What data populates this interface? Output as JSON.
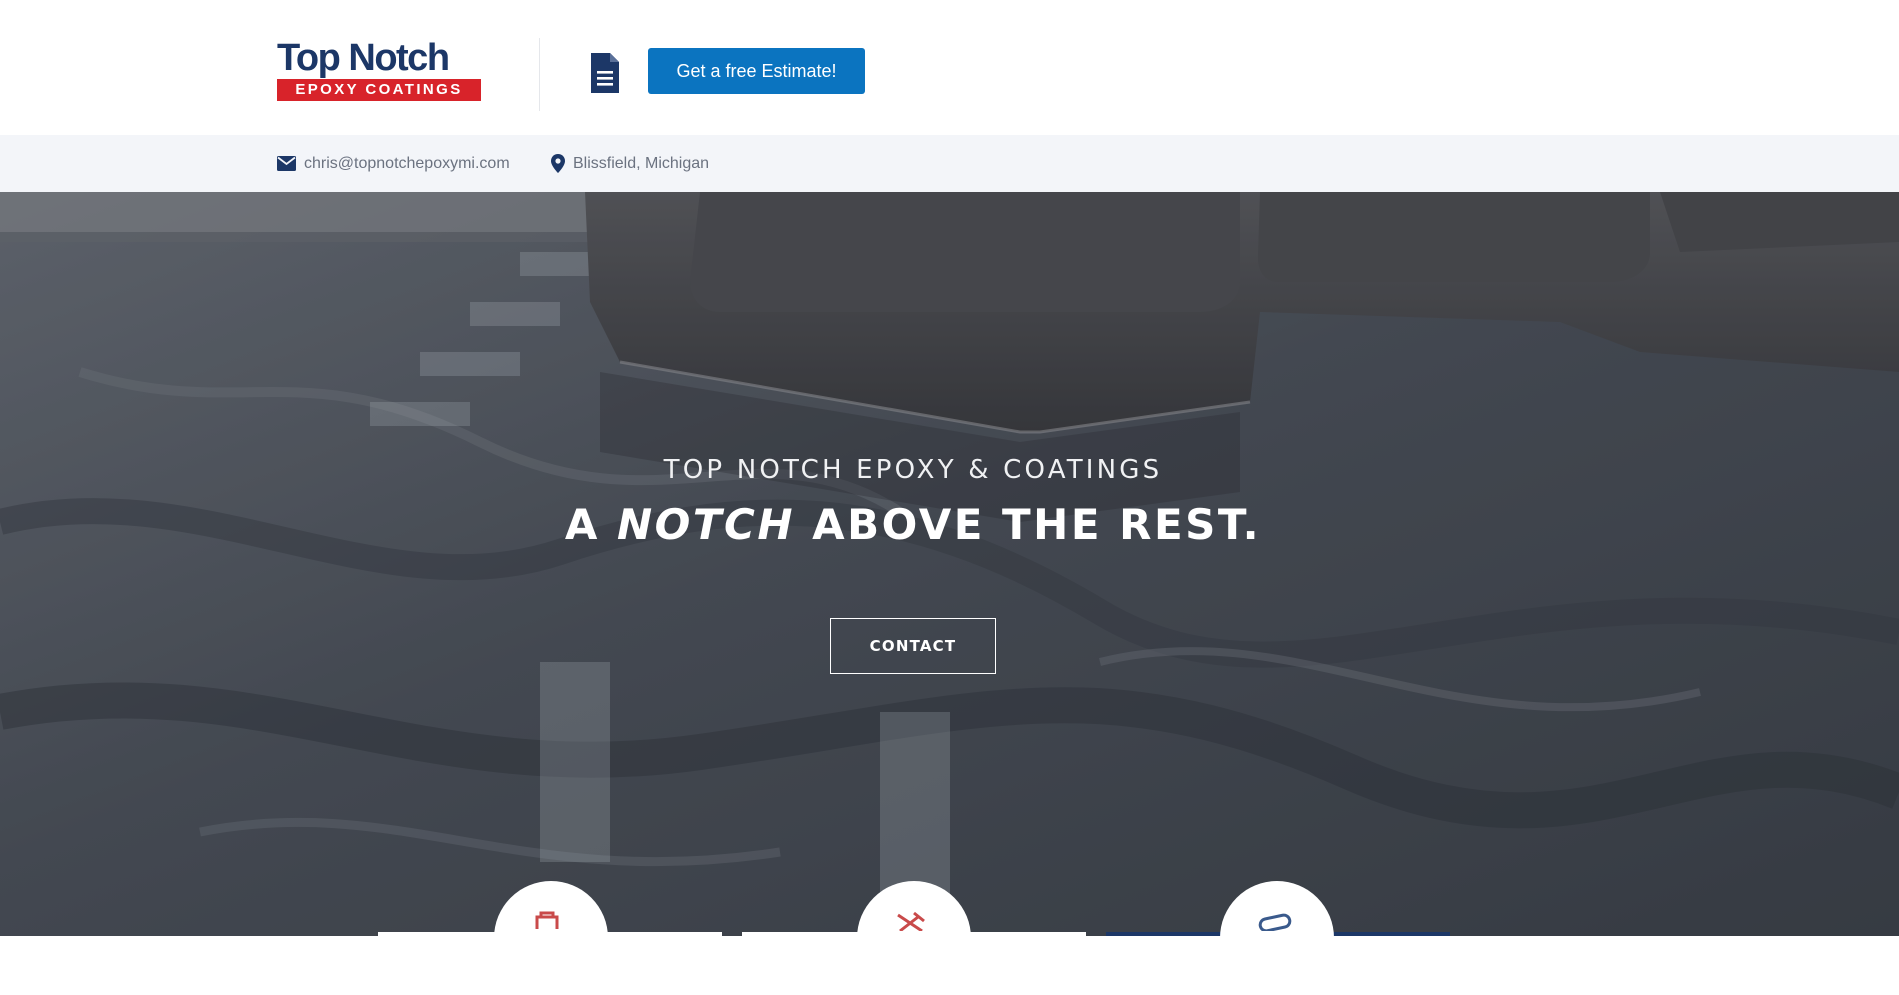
{
  "logo": {
    "line1": "Top Notch",
    "line2": "EPOXY COATINGS",
    "colors": {
      "navy": "#1c3767",
      "red": "#d8232a"
    }
  },
  "header": {
    "document_icon": "document-icon",
    "estimate_button": "Get a free Estimate!",
    "accent_color": "#0b74c0"
  },
  "contact": {
    "email": "chris@topnotchepoxymi.com",
    "email_icon": "envelope-icon",
    "location": "Blissfield, Michigan",
    "location_icon": "map-pin-icon"
  },
  "hero": {
    "subtitle": "TOP NOTCH EPOXY & COATINGS",
    "title_prefix": "A ",
    "title_emphasis": "NOTCH",
    "title_suffix": " ABOVE THE REST.",
    "contact_button": "CONTACT"
  },
  "features": [
    {
      "icon": "paint-roller-icon"
    },
    {
      "icon": "tools-icon"
    },
    {
      "icon": "sealing-icon"
    }
  ]
}
